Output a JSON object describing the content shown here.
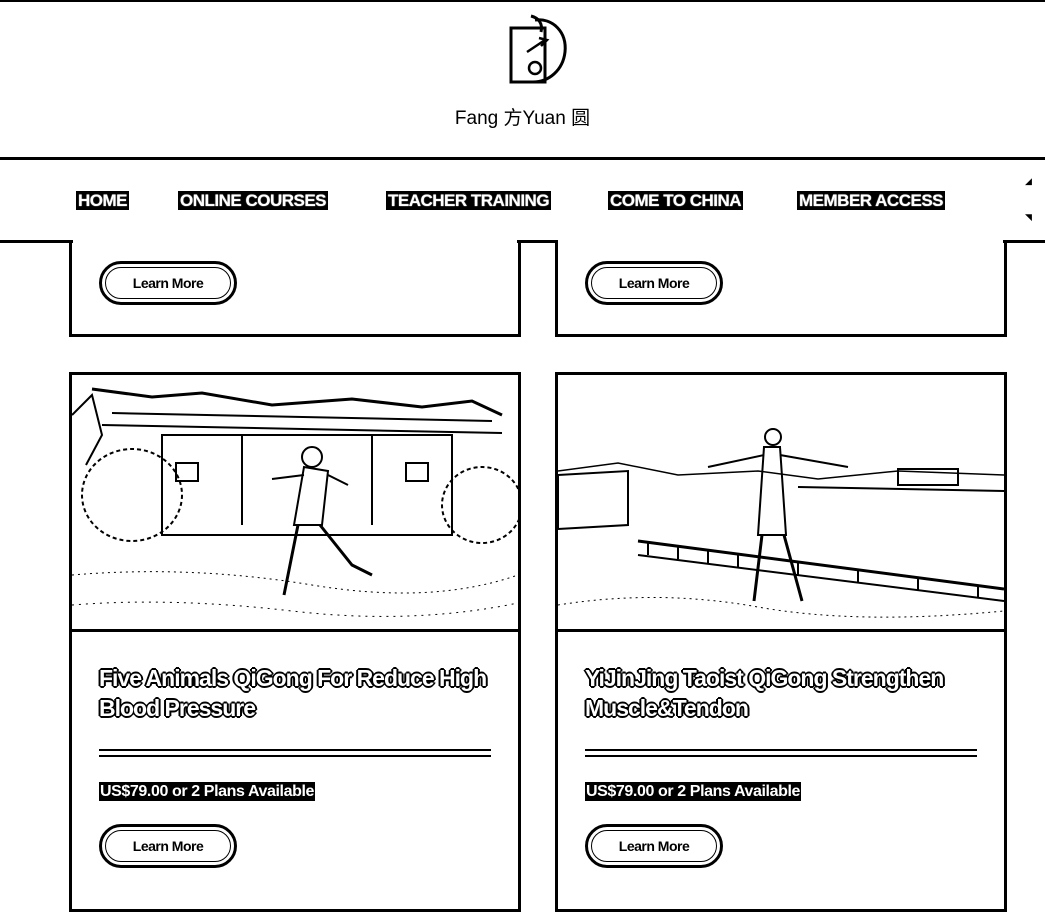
{
  "header": {
    "brand": "Fang 方Yuan 圆",
    "logo_icon": "fangyuan-logo-icon"
  },
  "nav": {
    "items": [
      {
        "label": "HOME"
      },
      {
        "label": "ONLINE COURSES"
      },
      {
        "label": "TEACHER TRAINING"
      },
      {
        "label": "COME TO CHINA"
      },
      {
        "label": "MEMBER ACCESS"
      }
    ],
    "scroll_up_icon": "triangle-up-icon",
    "scroll_down_icon": "triangle-down-icon"
  },
  "top_cards": [
    {
      "button_label": "Learn More"
    },
    {
      "button_label": "Learn More"
    }
  ],
  "cards": [
    {
      "image": "qigong-practitioner-courtyard-photo",
      "title": "Five Animals QiGong For Reduce High Blood Pressure",
      "price": "US$79.00 or 2 Plans Available",
      "button_label": "Learn More"
    },
    {
      "image": "qigong-practitioner-riverside-photo",
      "title": "YiJinJing Taoist QiGong Strengthen Muscle&Tendon",
      "price": "US$79.00 or 2 Plans Available",
      "button_label": "Learn More"
    }
  ],
  "colors": {
    "foreground": "#000000",
    "background": "#ffffff"
  }
}
